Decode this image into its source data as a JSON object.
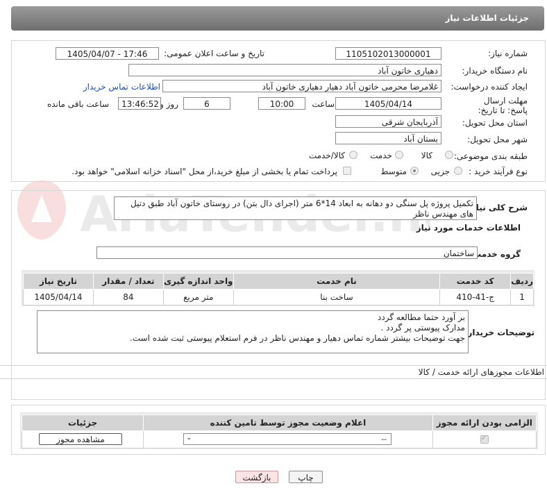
{
  "header": {
    "title": "جزئیات اطلاعات نیاز"
  },
  "form": {
    "need_number_label": "شماره نیاز:",
    "need_number": "1105102013000001",
    "announce_label": "تاریخ و ساعت اعلان عمومی:",
    "announce_value": "1405/04/07 - 17:46",
    "buyer_org_label": "نام دستگاه خریدار:",
    "buyer_org": "دهیاری خاتون آباد",
    "creator_label": "ایجاد کننده درخواست:",
    "creator": "غلامرضا محرمی خاتون آباد دهیار دهیاری خاتون آباد",
    "contact_link": "اطلاعات تماس خریدار",
    "deadline_label": "مهلت ارسال پاسخ: تا تاریخ:",
    "deadline_date": "1405/04/14",
    "time_label": "ساعت",
    "deadline_time": "10:00",
    "days_value": "6",
    "days_label": "روز و",
    "remaining_time": "13:46:52",
    "remaining_label": "ساعت باقی مانده",
    "province_label": "استان محل تحویل:",
    "province": "آذربایجان شرقی",
    "city_label": "شهر محل تحویل:",
    "city": "بستان آباد",
    "category_label": "طبقه بندی موضوعی:",
    "category_options": [
      "کالا",
      "خدمت",
      "کالا/خدمت"
    ],
    "category_selected": "",
    "process_label": "نوع فرآیند خرید :",
    "process_options": [
      "جزیی",
      "متوسط"
    ],
    "process_selected": "متوسط",
    "payment_note": "پرداخت تمام یا بخشی از مبلغ خرید،از محل \"اسناد خزانه اسلامی\" خواهد بود."
  },
  "description": {
    "label": "شرح کلی نیاز:",
    "text": "تکمیل  پروژه پل سنگی دو دهانه به ابعاد 14*6 متر (اجرای دال بتن)  در روستای خاتون آباد طبق دتیل های مهندس ناظر"
  },
  "services": {
    "section_title": "اطلاعات خدمات مورد نیاز",
    "group_label": "گروه خدمت:",
    "group_value": "ساختمان",
    "columns": [
      "ردیف",
      "کد خدمت",
      "نام خدمت",
      "واحد اندازه گیری",
      "تعداد / مقدار",
      "تاریخ نیاز"
    ],
    "rows": [
      [
        "1",
        "ج-41-410",
        "ساخت بنا",
        "متر مربع",
        "84",
        "1405/04/14"
      ]
    ]
  },
  "buyer_notes": {
    "label": "توضیحات خریدار:",
    "lines": [
      "بر آورد حتما مطالعه گردد",
      "مدارک پیوستی پر گردد .",
      "جهت توضیحات بیشتر شماره تماس دهیار و مهندس ناظر در فرم استعلام پیوستی ثبت شده است."
    ]
  },
  "permits": {
    "section_title": "اطلاعات مجوزهای ارائه خدمت / کالا",
    "columns": [
      "الزامی بودن ارائه مجوز",
      "اعلام وضعیت مجوز توسط تامین کننده",
      "جزئیات"
    ],
    "select_value": "--",
    "view_button": "مشاهده مجوز"
  },
  "actions": {
    "print": "چاپ",
    "back": "بازگشت"
  },
  "watermark": "AriaTender.neT"
}
